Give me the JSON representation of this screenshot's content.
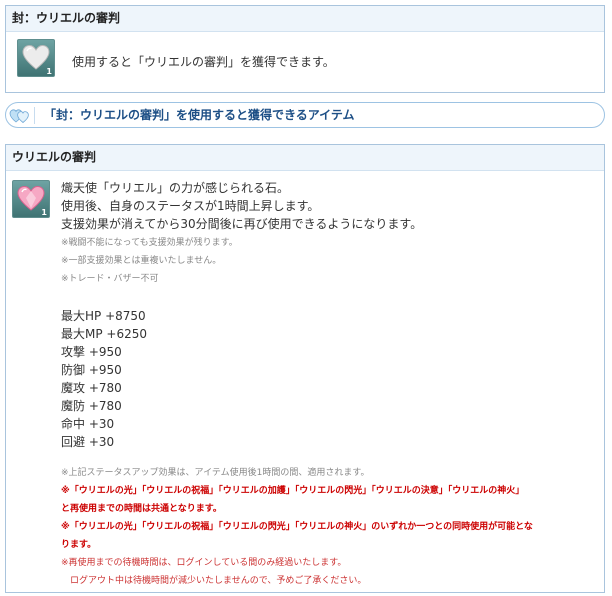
{
  "seal_box": {
    "title": "封：ウリエルの審判",
    "item_quantity": "1",
    "item_icon": "gray-heart-icon",
    "description": "使用すると「ウリエルの審判」を獲得できます。"
  },
  "obtain_bar": {
    "icon": "blue-hearts-icon",
    "text": "「封：ウリエルの審判」を使用すると獲得できるアイテム"
  },
  "item_box": {
    "title": "ウリエルの審判",
    "item_quantity": "1",
    "item_icon": "pink-heart-icon",
    "description": [
      "熾天使「ウリエル」の力が感じられる石。",
      "使用後、自身のステータスが1時間上昇します。",
      "支援効果が消えてから30分間後に再び使用できるようになります。"
    ],
    "notes": [
      "※戦闘不能になっても支援効果が残ります。",
      "※一部支援効果とは重複いたしません。",
      "※トレード・バザー不可"
    ],
    "stats": [
      "最大HP +8750",
      "最大MP +6250",
      "攻撃 +950",
      "防御 +950",
      "魔攻 +780",
      "魔防 +780",
      "命中 +30",
      "回避 +30"
    ],
    "footer_note": "※上記ステータスアップ効果は、アイテム使用後1時間の間、適用されます。",
    "warnings": [
      "※「ウリエルの光」「ウリエルの祝福」「ウリエルの加護」「ウリエルの閃光」「ウリエルの決意」「ウリエルの神火」",
      "と再使用までの時間は共通となります。",
      "※「ウリエルの光」「ウリエルの祝福」「ウリエルの閃光」「ウリエルの神火」のいずれか一つとの同時使用が可能とな",
      "ります。"
    ],
    "relog_notes": [
      "※再使用までの待機時間は、ログインしている間のみ経過いたします。",
      "　ログアウト中は待機時間が減少いたしませんので、予めご了承ください。"
    ]
  },
  "colors": {
    "header_bg": "#eef5fb",
    "border": "#a9c4dd",
    "pill_text": "#1d4f86",
    "warning": "#cc0000",
    "icon_bg": "#4f8585"
  }
}
